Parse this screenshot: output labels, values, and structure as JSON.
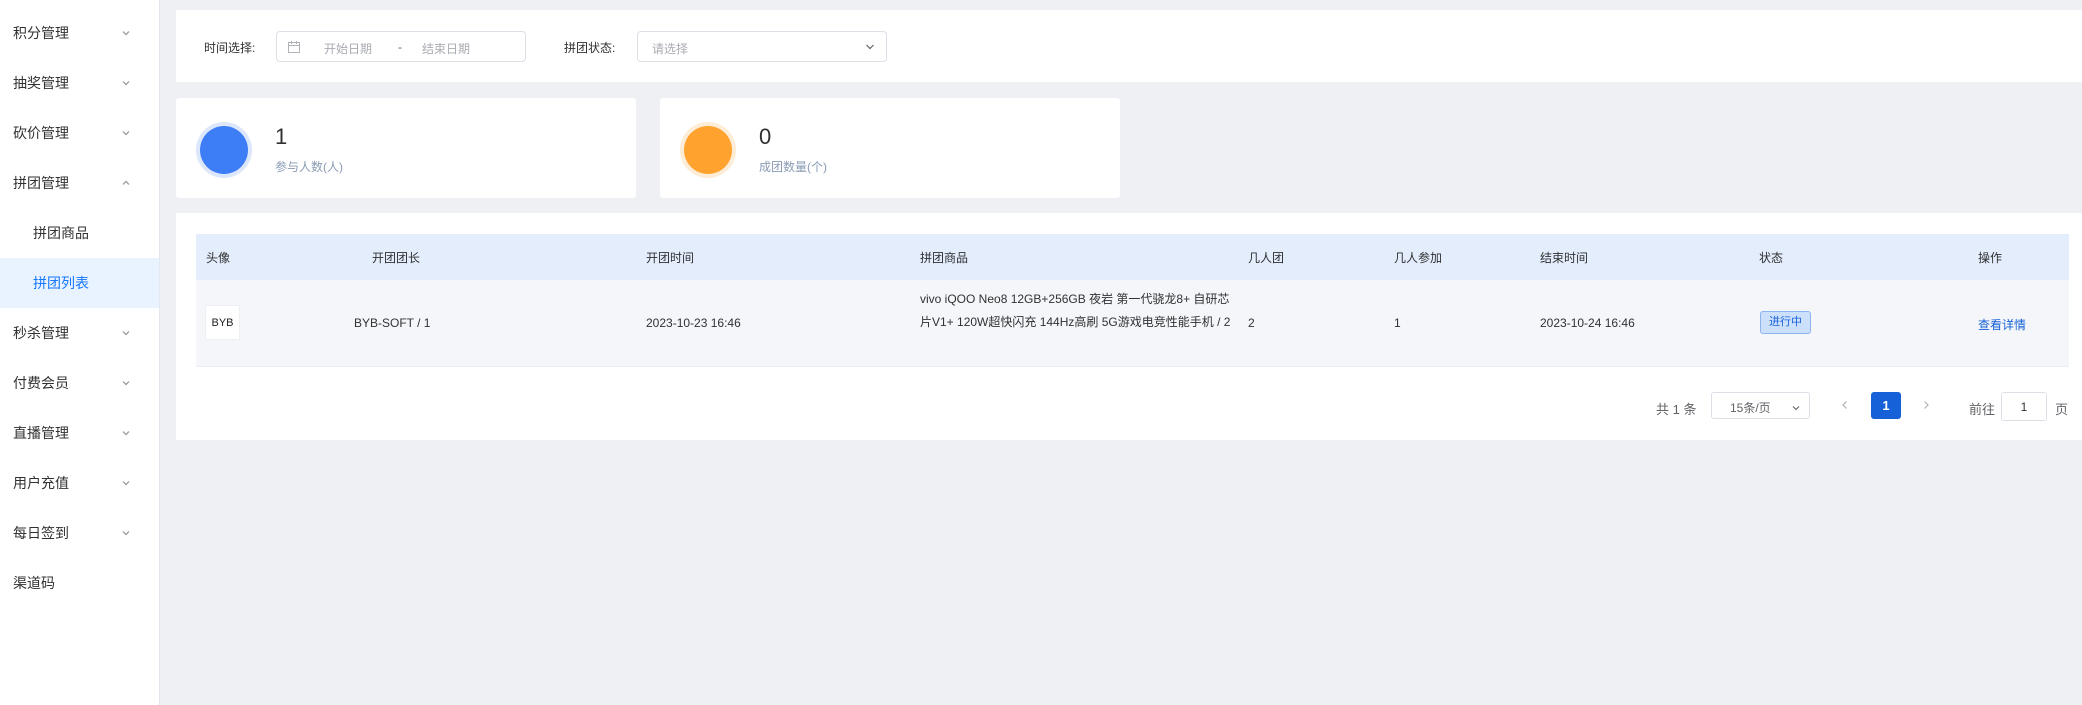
{
  "sidebar": {
    "items": [
      {
        "label": "积分管理",
        "expanded": false
      },
      {
        "label": "抽奖管理",
        "expanded": false
      },
      {
        "label": "砍价管理",
        "expanded": false
      },
      {
        "label": "拼团管理",
        "expanded": true
      },
      {
        "label": "拼团商品"
      },
      {
        "label": "拼团列表",
        "active": true
      },
      {
        "label": "秒杀管理",
        "expanded": false
      },
      {
        "label": "付费会员",
        "expanded": false
      },
      {
        "label": "直播管理",
        "expanded": false
      },
      {
        "label": "用户充值",
        "expanded": false
      },
      {
        "label": "每日签到",
        "expanded": false
      },
      {
        "label": "渠道码"
      }
    ]
  },
  "filter": {
    "time_label": "时间选择:",
    "start_placeholder": "开始日期",
    "range_separator": "-",
    "end_placeholder": "结束日期",
    "status_label": "拼团状态:",
    "status_placeholder": "请选择"
  },
  "stats": [
    {
      "value": "1",
      "label": "参与人数(人)",
      "color": "#3d7df5"
    },
    {
      "value": "0",
      "label": "成团数量(个)",
      "color": "#ffa22e"
    }
  ],
  "table": {
    "columns": [
      "头像",
      "开团团长",
      "开团时间",
      "拼团商品",
      "几人团",
      "几人参加",
      "结束时间",
      "状态",
      "操作"
    ],
    "rows": [
      {
        "avatar": "BYB",
        "leader": "BYB-SOFT / 1",
        "start_time": "2023-10-23 16:46",
        "goods": "vivo iQOO Neo8 12GB+256GB 夜岩 第一代骁龙8+ 自研芯片V1+ 120W超快闪充 144Hz高刷 5G游戏电竞性能手机 / 2",
        "group_size": "2",
        "joined": "1",
        "end_time": "2023-10-24 16:46",
        "status": "进行中",
        "action": "查看详情"
      }
    ]
  },
  "pagination": {
    "total": "共 1 条",
    "page_size": "15条/页",
    "current_page": "1",
    "goto_label": "前往",
    "goto_value": "1",
    "goto_unit": "页"
  },
  "colors": {
    "accent": "#1661d8",
    "header_bg": "#e3edfb",
    "active_menu_bg": "#e8f3ff"
  }
}
